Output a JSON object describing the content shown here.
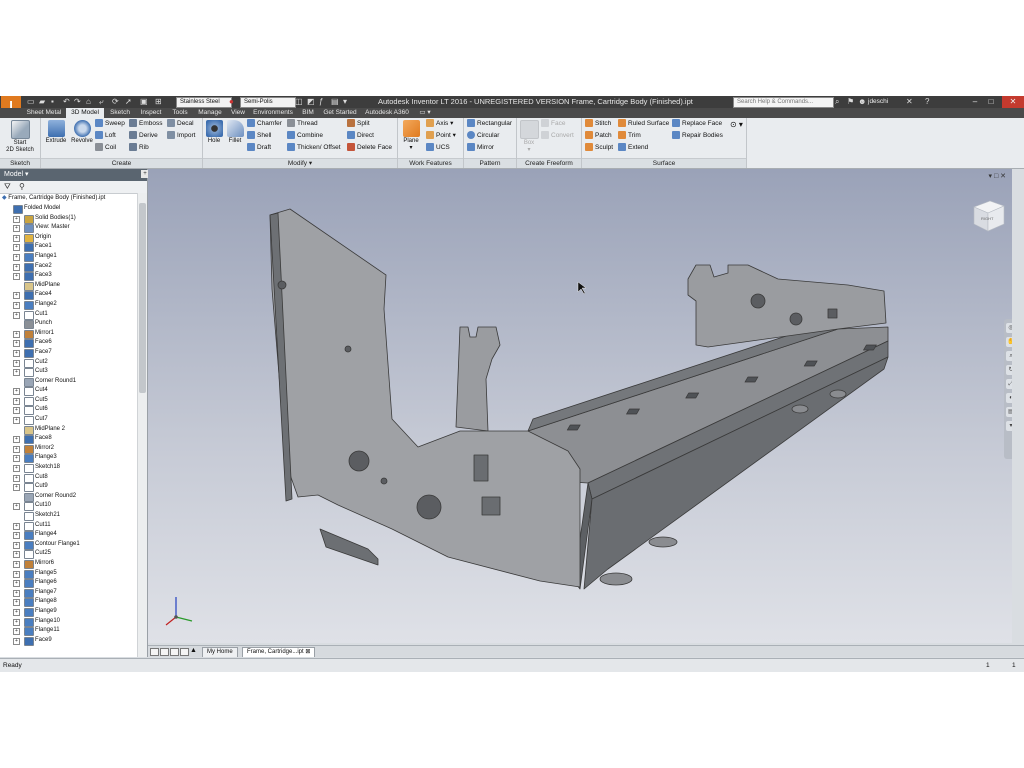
{
  "app": {
    "logo_letter": "I",
    "window_title": "Autodesk Inventor LT 2016 - UNREGISTERED VERSION   Frame, Cartridge Body (Finished).ipt",
    "search_placeholder": "Search Help & Commands...",
    "user": "jdeschi",
    "material": "Stainless Steel",
    "appearance": "Semi-Polis"
  },
  "tabs": [
    "Sheet Metal",
    "3D Model",
    "Sketch",
    "Inspect",
    "Tools",
    "Manage",
    "View",
    "Environments",
    "BIM",
    "Get Started",
    "Autodesk A360"
  ],
  "active_tab": "3D Model",
  "ribbon": {
    "sketch": {
      "title": "Sketch",
      "start": "Start",
      "sketch2d": "2D Sketch"
    },
    "create": {
      "title": "Create",
      "extrude": "Extrude",
      "revolve": "Revolve",
      "col1": [
        "Sweep",
        "Loft",
        "Coil"
      ],
      "col2": [
        "Emboss",
        "Derive",
        "Rib"
      ],
      "col3": [
        "Decal",
        "Import"
      ]
    },
    "modify": {
      "title": "Modify",
      "hole": "Hole",
      "fillet": "Fillet",
      "col1": [
        "Chamfer",
        "Shell",
        "Draft"
      ],
      "col2": [
        "Thread",
        "Combine",
        "Thicken/ Offset"
      ],
      "col3": [
        "Split",
        "Direct",
        "Delete Face"
      ]
    },
    "work": {
      "title": "Work Features",
      "plane": "Plane",
      "col1": [
        "Axis",
        "Point",
        "UCS"
      ]
    },
    "pattern": {
      "title": "Pattern",
      "col1": [
        "Rectangular",
        "Circular",
        "Mirror"
      ]
    },
    "freeform": {
      "title": "Create Freeform",
      "box": "Box",
      "col1": [
        "Face",
        "Convert"
      ]
    },
    "surface": {
      "title": "Surface",
      "col1": [
        "Stitch",
        "Patch",
        "Sculpt"
      ],
      "col2": [
        "Ruled Surface",
        "Trim",
        "Extend"
      ],
      "col3": [
        "Replace Face",
        "Repair Bodies"
      ]
    }
  },
  "browser": {
    "title": "Model",
    "root": "Frame, Cartridge Body (Finished).ipt",
    "items": [
      {
        "label": "Folded Model",
        "icon": "folded-model-icon"
      },
      {
        "label": "Solid Bodies(1)",
        "icon": "solid-bodies-icon"
      },
      {
        "label": "View: Master",
        "icon": "view-icon"
      },
      {
        "label": "Origin",
        "icon": "origin-folder-icon"
      },
      {
        "label": "Face1",
        "icon": "face-icon"
      },
      {
        "label": "Flange1",
        "icon": "flange-icon"
      },
      {
        "label": "Face2",
        "icon": "face-icon"
      },
      {
        "label": "Face3",
        "icon": "face-icon"
      },
      {
        "label": "MidPlane",
        "icon": "plane-icon"
      },
      {
        "label": "Face4",
        "icon": "face-icon"
      },
      {
        "label": "Flange2",
        "icon": "flange-icon"
      },
      {
        "label": "Cut1",
        "icon": "cut-icon"
      },
      {
        "label": "Punch",
        "icon": "punch-icon"
      },
      {
        "label": "Mirror1",
        "icon": "mirror-icon"
      },
      {
        "label": "Face6",
        "icon": "face-icon"
      },
      {
        "label": "Face7",
        "icon": "face-icon"
      },
      {
        "label": "Cut2",
        "icon": "cut-icon"
      },
      {
        "label": "Cut3",
        "icon": "cut-icon"
      },
      {
        "label": "Corner Round1",
        "icon": "corner-round-icon"
      },
      {
        "label": "Cut4",
        "icon": "cut-icon"
      },
      {
        "label": "Cut5",
        "icon": "cut-icon"
      },
      {
        "label": "Cut6",
        "icon": "cut-icon"
      },
      {
        "label": "Cut7",
        "icon": "cut-icon"
      },
      {
        "label": "MidPlane 2",
        "icon": "plane-icon"
      },
      {
        "label": "Face8",
        "icon": "face-icon"
      },
      {
        "label": "Mirror2",
        "icon": "mirror-icon"
      },
      {
        "label": "Flange3",
        "icon": "flange-icon"
      },
      {
        "label": "Sketch18",
        "icon": "sketch-icon"
      },
      {
        "label": "Cut8",
        "icon": "cut-icon"
      },
      {
        "label": "Cut9",
        "icon": "cut-icon"
      },
      {
        "label": "Corner Round2",
        "icon": "corner-round-icon"
      },
      {
        "label": "Cut10",
        "icon": "cut-icon"
      },
      {
        "label": "Sketch21",
        "icon": "sketch-icon"
      },
      {
        "label": "Cut11",
        "icon": "cut-icon"
      },
      {
        "label": "Flange4",
        "icon": "flange-icon"
      },
      {
        "label": "Contour Flange1",
        "icon": "contour-flange-icon"
      },
      {
        "label": "Cut25",
        "icon": "cut-icon"
      },
      {
        "label": "Mirror6",
        "icon": "mirror-icon"
      },
      {
        "label": "Flange5",
        "icon": "flange-icon"
      },
      {
        "label": "Flange6",
        "icon": "flange-icon"
      },
      {
        "label": "Flange7",
        "icon": "flange-icon"
      },
      {
        "label": "Flange8",
        "icon": "flange-icon"
      },
      {
        "label": "Flange9",
        "icon": "flange-icon"
      },
      {
        "label": "Flange10",
        "icon": "flange-icon"
      },
      {
        "label": "Flange11",
        "icon": "flange-icon"
      },
      {
        "label": "Face9",
        "icon": "face-icon"
      }
    ]
  },
  "viewcube_label": "RIGHT",
  "doc_tabs": [
    "My Home",
    "Frame, Cartridge...ipt"
  ],
  "status": {
    "text": "Ready",
    "count1": "1",
    "count2": "1"
  },
  "colors": {
    "accent": "#e07a1f",
    "face_icon": "#3e6fb0",
    "close": "#c43a2e"
  }
}
